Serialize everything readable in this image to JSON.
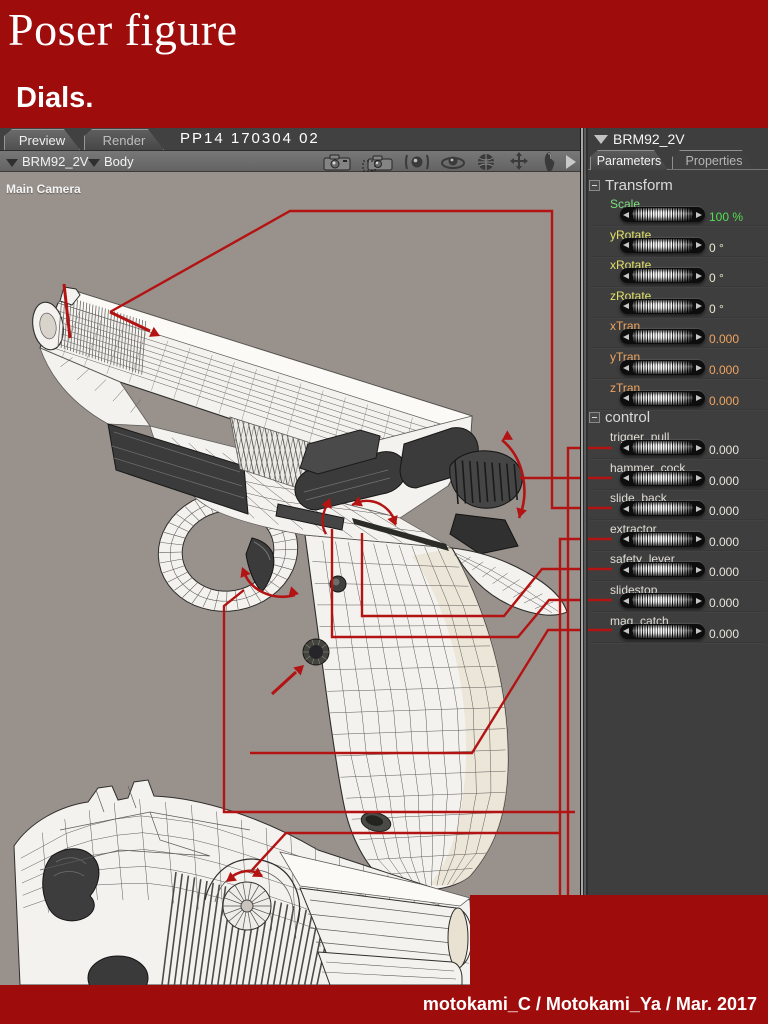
{
  "banner": {
    "title": "Poser figure",
    "subtitle": "Dials."
  },
  "workspace": {
    "tabs": [
      {
        "label": "Preview",
        "active": true
      },
      {
        "label": "Render",
        "active": false
      }
    ],
    "doc_title": "PP14  170304  02",
    "toolbar": {
      "figure_selector": "BRM92_2V",
      "part_selector": "Body",
      "camera_icons": [
        "camera-icon",
        "camera-dolly-icon",
        "orbit-sphere-icon",
        "rotate-sphere-icon",
        "globe-icon",
        "move-cross-icon",
        "hand-icon"
      ],
      "next_arrow_icon": "next-arrow-icon"
    },
    "camera_label": "Main Camera"
  },
  "panel": {
    "figure_name": "BRM92_2V",
    "tabs": [
      {
        "label": "Parameters",
        "active": true
      },
      {
        "label": "Properties",
        "active": false
      }
    ],
    "groups": [
      {
        "name": "Transform",
        "dials": [
          {
            "label": "Scale",
            "value": "100 %",
            "label_color": "#7de07d",
            "value_color": "#55dd55"
          },
          {
            "label": "yRotate",
            "value": "0 °",
            "label_color": "#e2e26a",
            "value_color": "#ecead0"
          },
          {
            "label": "xRotate",
            "value": "0 °",
            "label_color": "#e2e26a",
            "value_color": "#ecead0"
          },
          {
            "label": "zRotate",
            "value": "0 °",
            "label_color": "#e2e26a",
            "value_color": "#ecead0"
          },
          {
            "label": "xTran",
            "value": "0.000",
            "label_color": "#f0a45f",
            "value_color": "#f0a45f"
          },
          {
            "label": "yTran",
            "value": "0.000",
            "label_color": "#f0a45f",
            "value_color": "#f0a45f"
          },
          {
            "label": "zTran",
            "value": "0.000",
            "label_color": "#f0a45f",
            "value_color": "#f0a45f"
          }
        ]
      },
      {
        "name": "control",
        "dials": [
          {
            "label": "trigger_pull",
            "value": "0.000",
            "label_color": "#e0ddd6",
            "value_color": "#e8e5dc"
          },
          {
            "label": "hammer_cock",
            "value": "0.000",
            "label_color": "#e0ddd6",
            "value_color": "#e8e5dc"
          },
          {
            "label": "slide_back",
            "value": "0.000",
            "label_color": "#e0ddd6",
            "value_color": "#e8e5dc"
          },
          {
            "label": "extractor",
            "value": "0.000",
            "label_color": "#e0ddd6",
            "value_color": "#e8e5dc"
          },
          {
            "label": "safety_lever",
            "value": "0.000",
            "label_color": "#e0ddd6",
            "value_color": "#e8e5dc"
          },
          {
            "label": "slidestop",
            "value": "0.000",
            "label_color": "#e0ddd6",
            "value_color": "#e8e5dc"
          },
          {
            "label": "mag_catch",
            "value": "0.000",
            "label_color": "#e0ddd6",
            "value_color": "#e8e5dc"
          }
        ]
      }
    ]
  },
  "footer": {
    "credit": "motokami_C / Motokami_Ya / Mar. 2017"
  },
  "colors": {
    "banner_red": "#9e0c0c",
    "annotation_red": "#b31313",
    "viewport_grey": "#99928c",
    "panel_grey": "#3e3e3e"
  }
}
